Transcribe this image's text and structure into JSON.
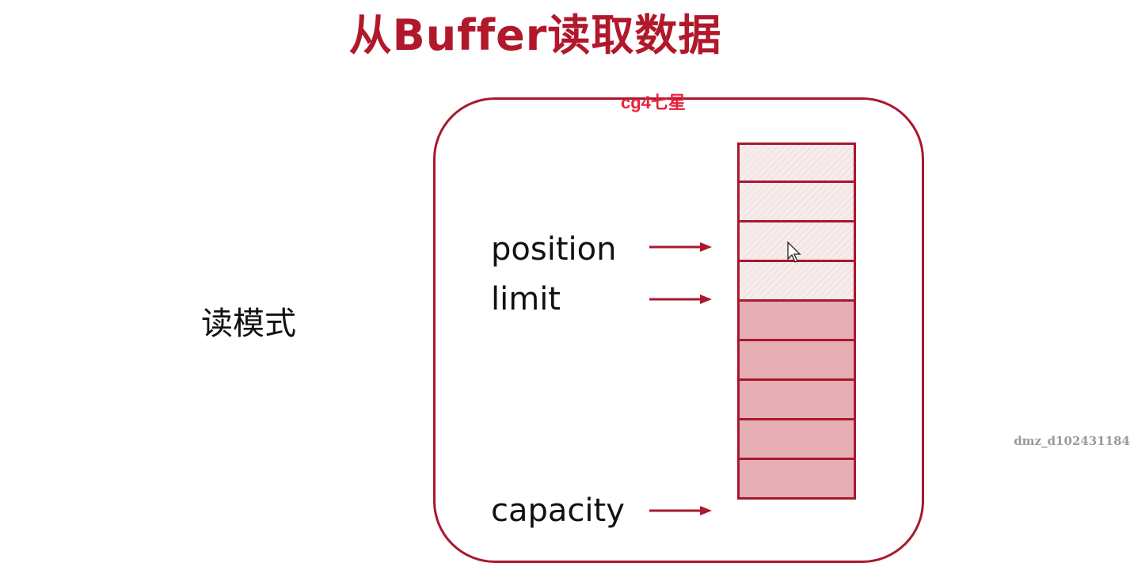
{
  "title": "从Buffer读取数据",
  "overlay_tag": "cg4七星",
  "mode_label": "读模式",
  "pointers": [
    {
      "id": "position",
      "label": "position"
    },
    {
      "id": "limit",
      "label": "limit"
    },
    {
      "id": "capacity",
      "label": "capacity"
    }
  ],
  "buffer": {
    "cells_total": 9,
    "cells_empty": 4,
    "cells_filled": 5
  },
  "watermark": "dmz_d102431184",
  "colors": {
    "accent": "#a8182e",
    "title": "#b2182b",
    "filled_cell": "#e5aeb4",
    "overlay_tag": "#e8213a"
  }
}
